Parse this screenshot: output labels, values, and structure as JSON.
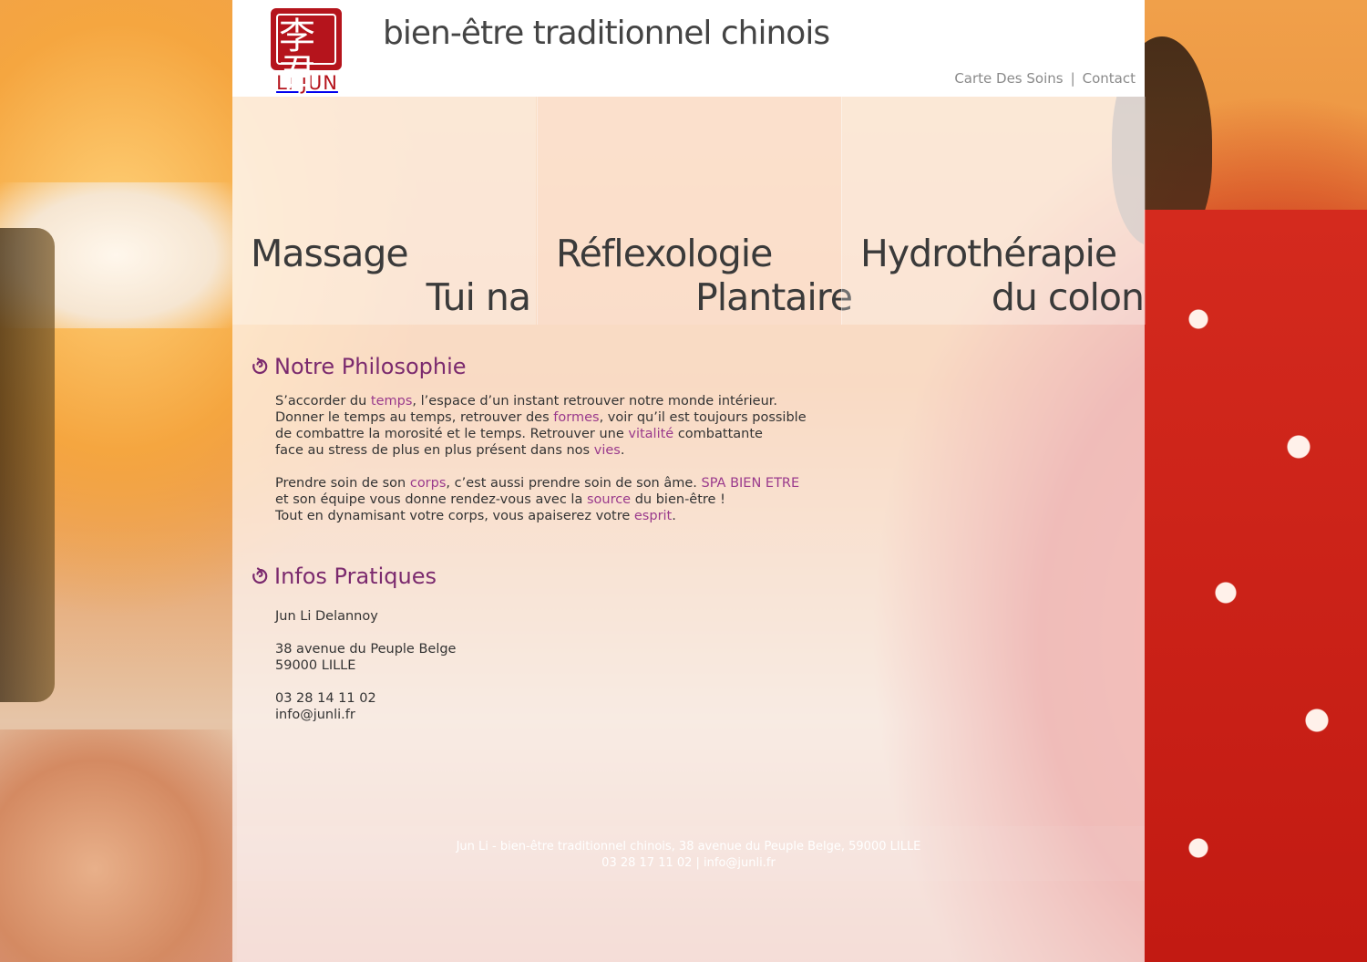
{
  "header": {
    "logo_text": "LI JUN",
    "site_title": "bien-être traditionnel chinois",
    "nav": [
      {
        "label": "Carte Des Soins"
      },
      {
        "label": "Contact"
      }
    ]
  },
  "services": [
    {
      "line1": "Massage",
      "line2": "Tui na"
    },
    {
      "line1": "Réflexologie",
      "line2": "Plantaire"
    },
    {
      "line1": "Hydrothérapie",
      "line2": "du colon"
    }
  ],
  "philosophy": {
    "title": "Notre Philosophie",
    "p1": [
      "S’accorder du ",
      "temps",
      ", l’espace d’un instant retrouver notre monde intérieur.",
      "Donner le temps au temps, retrouver des ",
      "formes",
      ", voir qu’il est toujours possible",
      "de combattre la morosité et le temps. Retrouver une ",
      "vitalité",
      " combattante",
      "face au stress de plus en plus présent dans nos ",
      "vies",
      "."
    ],
    "p2": [
      "Prendre soin de son ",
      "corps",
      ", c’est aussi prendre soin de son âme. ",
      "SPA BIEN ETRE",
      "et son équipe vous donne rendez-vous avec la ",
      "source",
      " du bien-être !",
      "Tout en dynamisant votre corps, vous apaiserez votre ",
      "esprit",
      "."
    ]
  },
  "infos": {
    "title": "Infos Pratiques",
    "name": "Jun Li Delannoy",
    "street": "38 avenue du Peuple Belge",
    "city": "59000 LILLE",
    "phone": "03 28 14 11 02",
    "email": "info@junli.fr"
  },
  "footer": {
    "line1": "Jun Li - bien-être traditionnel chinois, 38 avenue du Peuple Belge, 59000 LILLE",
    "line2": "03 28 17 11 02  |  info@junli.fr"
  },
  "colors": {
    "accent": "#7b2a6e",
    "highlight": "#9a3a8c",
    "seal_red": "#b5141c"
  }
}
